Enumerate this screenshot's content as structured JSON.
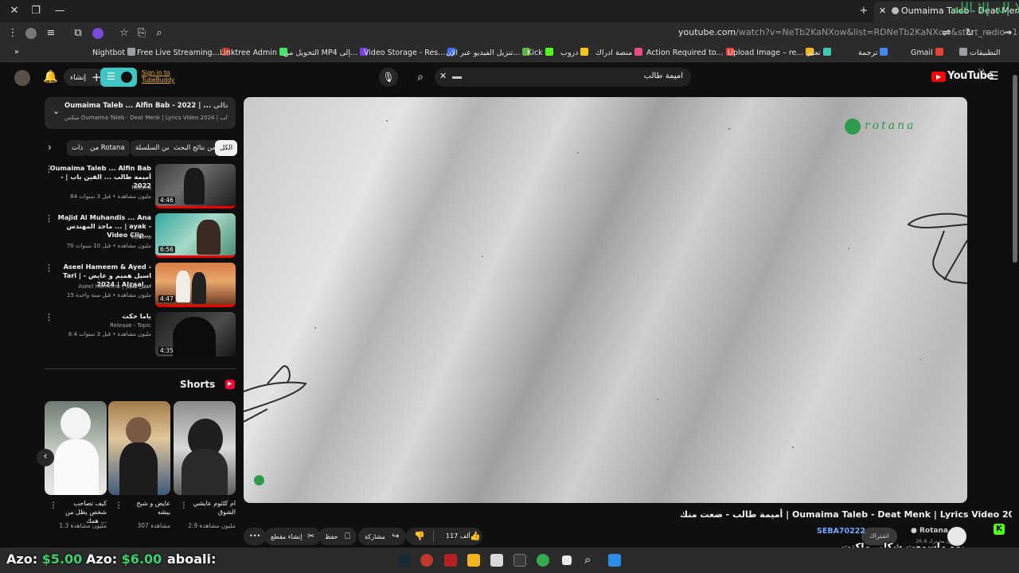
{
  "titlebar": {
    "tab_title": "Oumaima Taleb - Deat Menk",
    "watermark": "لا إله إلا الله"
  },
  "addressbar": {
    "url_host": "youtube.com",
    "url_path": "/watch?v=NeTb2KaNXow&list=RDNeTb2KaNXow&start_radio=1"
  },
  "bookmarks": [
    {
      "label": "Nightbot",
      "color": "#9aa0a6"
    },
    {
      "label": "Free Live Streaming...",
      "color": "#c0392b"
    },
    {
      "label": "Linktree Admin",
      "color": "#43e660"
    },
    {
      "label": "التحويل من MP4 إلى...",
      "color": "#7b3fe4"
    },
    {
      "label": "Video Storage - Res...",
      "color": "#3b6cf6"
    },
    {
      "label": "تنزيل الفيديو عبر الإن...",
      "color": "#5fb43c"
    },
    {
      "label": "Kick",
      "color": "#53fc18"
    },
    {
      "label": "دروب",
      "color": "#f5c518"
    },
    {
      "label": "منصة ادراك",
      "color": "#e94b8a"
    },
    {
      "label": "Action Required to...",
      "color": "#ea4335"
    },
    {
      "label": "Upload Image – re...",
      "color": "#f2b51f"
    },
    {
      "label": "تعلم",
      "color": "#41c6b4"
    },
    {
      "label": "ترجمة",
      "color": "#4285f4"
    },
    {
      "label": "Gmail",
      "color": "#ea4335"
    },
    {
      "label": "التطبيقات",
      "color": "#9aa0a6"
    }
  ],
  "header": {
    "create_label": "إنشاء",
    "sign_in_line1": "Sign in to",
    "sign_in_line2": "TubeBuddy",
    "search_value": "اميمة طالب",
    "logo_text": "YouTube",
    "country": "SA"
  },
  "nowplaying": {
    "prefix": "التالي:",
    "title": "Oumaima Taleb ... Alfin Bab - 2022 | ... الفين باب ...",
    "subtitle": "ميكس Oumaima Taleb - Deat Menk | Lyrics Video 2024 | اميمة طالب"
  },
  "chips": [
    {
      "label": "الكل",
      "active": true
    },
    {
      "label": "من نتائج البحث"
    },
    {
      "label": "من السلسلة"
    },
    {
      "label": "من Rotana"
    },
    {
      "label": "ذات"
    }
  ],
  "related": [
    {
      "title": "Oumaima Taleb ... Alfin Bab - أميمة طالب ... الفين باب | 2022",
      "channel": "Rotana",
      "meta": "84 مليون مشاهدة • قبل 3 سنوات",
      "duration": "4:46"
    },
    {
      "title": "Majid Al Muhandis ... Ana ماجد المهندس ... | ayak - Video Clip...",
      "channel": "Rotana",
      "meta": "70 مليون مشاهدة • قبل 10 سنوات",
      "duration": "6:56"
    },
    {
      "title": "Aseel Hameem & Ayed - Tari اسيل هميم و عايض - | 2024 | Alzaal...",
      "channel": "Aseel Hameem | اسيل هميم",
      "meta": "15 مليون مشاهدة • قبل سنة واحدة",
      "duration": "4:47"
    },
    {
      "title": "ياما حكت",
      "channel": "Release - Topic",
      "meta": "6.4 مليون مشاهدة • قبل 3 سنوات",
      "duration": "4:35"
    }
  ],
  "shorts": {
    "heading": "Shorts",
    "items": [
      {
        "title": "ام كلثوم عايشي الشوق",
        "views": "2.9 مليون مشاهدة"
      },
      {
        "title": "عايض و شيخ بيشه",
        "views": "307 مشاهدة"
      },
      {
        "title": "كيف تصاحب شخص يظل من همك ...",
        "views": "1.3 مليون مشاهدة"
      }
    ]
  },
  "player": {
    "brand": "rotana"
  },
  "video": {
    "title": "أميمة طالب - ضعت منك | Oumaima Taleb - Deat Menk | Lyrics Video 2024",
    "channel": "Rotana",
    "subs": "26.8 مليون مشترك",
    "subscribe": "اشتراك",
    "likes": "117 ألف",
    "share": "مشاركة",
    "save": "حفظ",
    "clip": "إنشاء مقطع"
  },
  "chat_overlay": {
    "user": "SEBA70222",
    "message": "يوه ماسمعت شكلي ماكنت موجوده"
  },
  "stream_overlay": {
    "azo1_label": "Azo:",
    "azo1_value": "$5.00",
    "azo2_label": "Azo:",
    "azo2_value": "$6.00",
    "name": "aboali:"
  }
}
